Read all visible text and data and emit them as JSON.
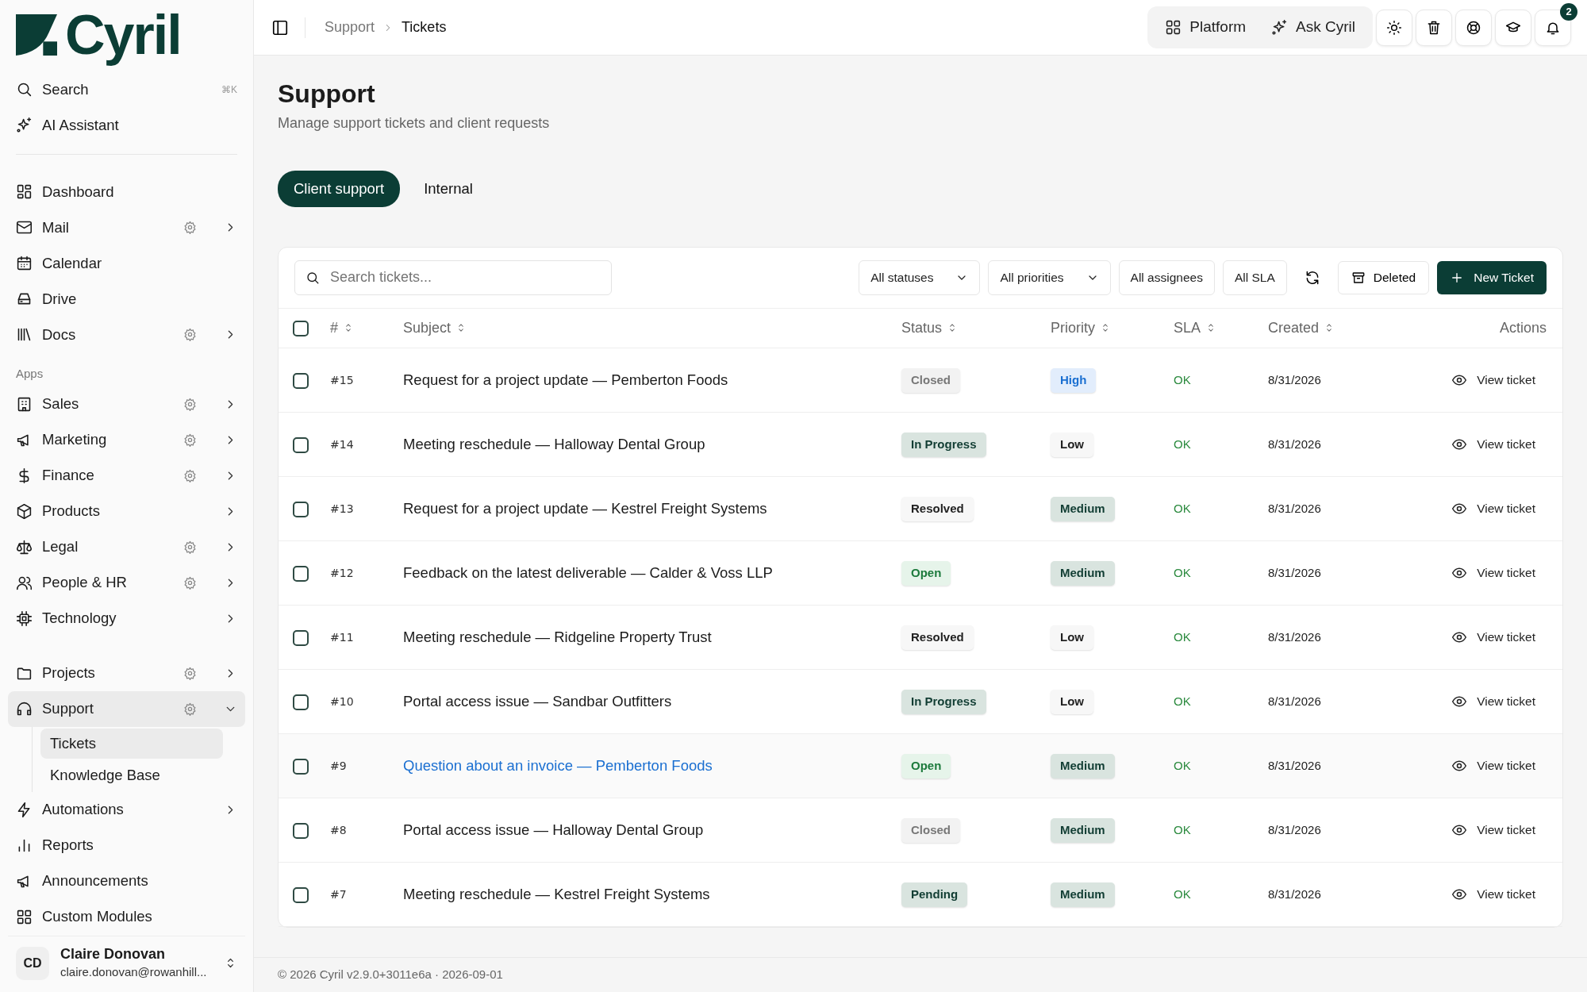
{
  "sidebar": {
    "logo": "Cyril",
    "search": {
      "label": "Search",
      "shortcut": "⌘K"
    },
    "assistant": {
      "label": "AI Assistant"
    },
    "groups": [
      {
        "items": [
          {
            "label": "Dashboard",
            "settings": false,
            "expandable": false,
            "selected": false
          },
          {
            "label": "Mail",
            "settings": true,
            "expandable": true,
            "expanded": false,
            "selected": false
          },
          {
            "label": "Calendar",
            "settings": false,
            "expandable": false,
            "selected": false
          },
          {
            "label": "Drive",
            "settings": false,
            "expandable": false,
            "selected": false
          },
          {
            "label": "Docs",
            "settings": true,
            "expandable": true,
            "expanded": false,
            "selected": false
          }
        ]
      },
      {
        "heading": "Apps",
        "items": [
          {
            "label": "Sales",
            "settings": true,
            "expandable": true,
            "expanded": false,
            "selected": false
          },
          {
            "label": "Marketing",
            "settings": true,
            "expandable": true,
            "expanded": false,
            "selected": false
          },
          {
            "label": "Finance",
            "settings": true,
            "expandable": true,
            "expanded": false,
            "selected": false
          },
          {
            "label": "Products",
            "settings": false,
            "expandable": true,
            "expanded": false,
            "selected": false
          },
          {
            "label": "Legal",
            "settings": true,
            "expandable": true,
            "expanded": false,
            "selected": false
          },
          {
            "label": "People & HR",
            "settings": true,
            "expandable": true,
            "expanded": false,
            "selected": false
          },
          {
            "label": "Technology",
            "settings": false,
            "expandable": true,
            "expanded": false,
            "selected": false
          }
        ]
      },
      {
        "items": [
          {
            "label": "Projects",
            "settings": true,
            "expandable": true,
            "expanded": false,
            "selected": false
          },
          {
            "label": "Support",
            "settings": true,
            "expandable": true,
            "expanded": true,
            "selected": true,
            "children": [
              {
                "label": "Tickets",
                "selected": true
              },
              {
                "label": "Knowledge Base",
                "selected": false
              }
            ]
          },
          {
            "label": "Automations",
            "settings": false,
            "expandable": true,
            "expanded": false,
            "selected": false
          },
          {
            "label": "Reports",
            "settings": false,
            "expandable": false,
            "selected": false
          },
          {
            "label": "Announcements",
            "settings": false,
            "expandable": false,
            "selected": false
          },
          {
            "label": "Custom Modules",
            "settings": false,
            "expandable": false,
            "selected": false
          }
        ]
      }
    ],
    "user": {
      "initials": "CD",
      "name": "Claire Donovan",
      "email": "claire.donovan@rowanhill..."
    }
  },
  "header": {
    "breadcrumb": [
      "Support",
      "Tickets"
    ],
    "quick_buttons": [
      "Platform",
      "Ask Cyril"
    ],
    "notification_count": "2"
  },
  "page": {
    "title": "Support",
    "subtitle": "Manage support tickets and client requests",
    "tabs": [
      {
        "label": "Client support",
        "selected": true
      },
      {
        "label": "Internal",
        "selected": false
      }
    ]
  },
  "toolbar": {
    "search": {
      "placeholder": "Search tickets..."
    },
    "filters": [
      {
        "label": "All statuses",
        "kind": "dropdown"
      },
      {
        "label": "All priorities",
        "kind": "dropdown"
      },
      {
        "label": "All assignees",
        "kind": "button"
      },
      {
        "label": "All SLA",
        "kind": "button"
      }
    ],
    "deleted_button": "Deleted",
    "new_button": "New Ticket"
  },
  "table": {
    "select_all": {
      "checked": false
    },
    "columns": [
      {
        "label": "#",
        "sortable": true
      },
      {
        "label": "Subject",
        "sortable": true
      },
      {
        "label": "Status",
        "sortable": true
      },
      {
        "label": "Priority",
        "sortable": true
      },
      {
        "label": "SLA",
        "sortable": true
      },
      {
        "label": "Created",
        "sortable": true
      },
      {
        "label": "Actions",
        "sortable": false
      }
    ],
    "rows": [
      {
        "checked": false,
        "hovered": false,
        "number": "#15",
        "subject": "Request for a project update — Pemberton Foods",
        "status": {
          "label": "Closed",
          "kind": "muted"
        },
        "priority": {
          "label": "High",
          "kind": "info"
        },
        "sla": "OK",
        "created": "8/31/2026",
        "action": "View ticket"
      },
      {
        "checked": false,
        "hovered": false,
        "number": "#14",
        "subject": "Meeting reschedule — Halloway Dental Group",
        "status": {
          "label": "In Progress",
          "kind": "accent"
        },
        "priority": {
          "label": "Low",
          "kind": "plain"
        },
        "sla": "OK",
        "created": "8/31/2026",
        "action": "View ticket"
      },
      {
        "checked": false,
        "hovered": false,
        "number": "#13",
        "subject": "Request for a project update — Kestrel Freight Systems",
        "status": {
          "label": "Resolved",
          "kind": "plain"
        },
        "priority": {
          "label": "Medium",
          "kind": "accent"
        },
        "sla": "OK",
        "created": "8/31/2026",
        "action": "View ticket"
      },
      {
        "checked": false,
        "hovered": false,
        "number": "#12",
        "subject": "Feedback on the latest deliverable — Calder & Voss LLP",
        "status": {
          "label": "Open",
          "kind": "success"
        },
        "priority": {
          "label": "Medium",
          "kind": "accent"
        },
        "sla": "OK",
        "created": "8/31/2026",
        "action": "View ticket"
      },
      {
        "checked": false,
        "hovered": false,
        "number": "#11",
        "subject": "Meeting reschedule — Ridgeline Property Trust",
        "status": {
          "label": "Resolved",
          "kind": "plain"
        },
        "priority": {
          "label": "Low",
          "kind": "plain"
        },
        "sla": "OK",
        "created": "8/31/2026",
        "action": "View ticket"
      },
      {
        "checked": false,
        "hovered": false,
        "number": "#10",
        "subject": "Portal access issue — Sandbar Outfitters",
        "status": {
          "label": "In Progress",
          "kind": "accent"
        },
        "priority": {
          "label": "Low",
          "kind": "plain"
        },
        "sla": "OK",
        "created": "8/31/2026",
        "action": "View ticket"
      },
      {
        "checked": false,
        "hovered": true,
        "number": "#9",
        "subject": "Question about an invoice — Pemberton Foods",
        "status": {
          "label": "Open",
          "kind": "success"
        },
        "priority": {
          "label": "Medium",
          "kind": "accent"
        },
        "sla": "OK",
        "created": "8/31/2026",
        "action": "View ticket"
      },
      {
        "checked": false,
        "hovered": false,
        "number": "#8",
        "subject": "Portal access issue — Halloway Dental Group",
        "status": {
          "label": "Closed",
          "kind": "muted"
        },
        "priority": {
          "label": "Medium",
          "kind": "accent"
        },
        "sla": "OK",
        "created": "8/31/2026",
        "action": "View ticket"
      },
      {
        "checked": false,
        "hovered": false,
        "number": "#7",
        "subject": "Meeting reschedule — Kestrel Freight Systems",
        "status": {
          "label": "Pending",
          "kind": "accent"
        },
        "priority": {
          "label": "Medium",
          "kind": "accent"
        },
        "sla": "OK",
        "created": "8/31/2026",
        "action": "View ticket"
      }
    ]
  },
  "footer": "© 2026 Cyril v2.9.0+3011e6a · 2026-09-01"
}
